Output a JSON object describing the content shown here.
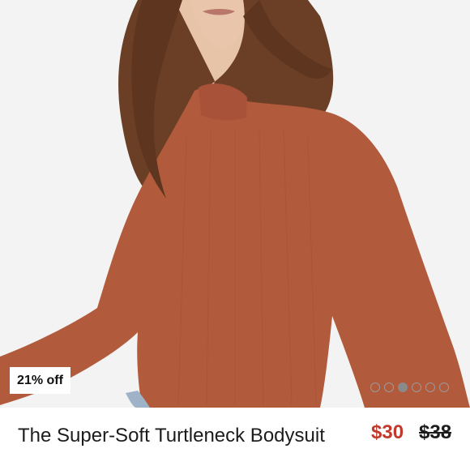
{
  "listing": {
    "badge": "21% off",
    "title": "The Super-Soft Turtleneck Bodysuit",
    "price_current": "$30",
    "price_original": "$38"
  },
  "carousel": {
    "dot_count": 6,
    "active_index": 2
  },
  "colors": {
    "sale_price": "#c2392b",
    "garment": "#b25a3c",
    "background": "#f3f3f3"
  },
  "icons": {
    "carousel_indicator": "dot-indicator-icon"
  }
}
